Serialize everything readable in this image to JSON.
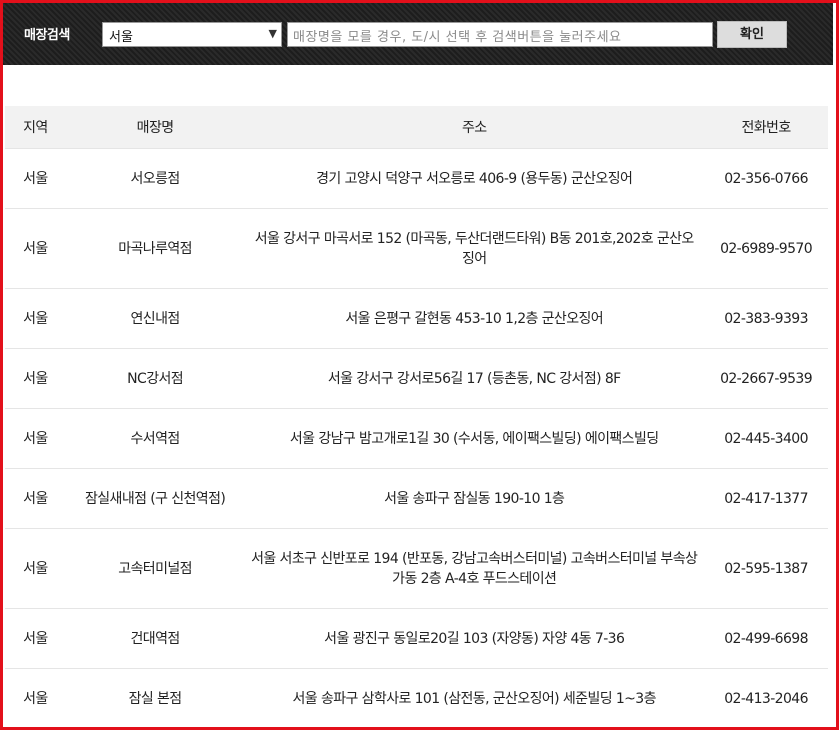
{
  "search": {
    "label": "매장검색",
    "region_value": "서울",
    "placeholder": "매장명을 모를 경우, 도/시 선택 후 검색버튼을 눌러주세요",
    "confirm_label": "확인"
  },
  "table": {
    "headers": {
      "region": "지역",
      "name": "매장명",
      "address": "주소",
      "phone": "전화번호"
    },
    "rows": [
      {
        "region": "서울",
        "name": "서오릉점",
        "address": "경기 고양시 덕양구 서오릉로 406-9 (용두동) 군산오징어",
        "phone": "02-356-0766"
      },
      {
        "region": "서울",
        "name": "마곡나루역점",
        "address": "서울 강서구 마곡서로 152 (마곡동, 두산더랜드타워) B동 201호,202호 군산오징어",
        "phone": "02-6989-9570"
      },
      {
        "region": "서울",
        "name": "연신내점",
        "address": "서울 은평구 갈현동 453-10 1,2층 군산오징어",
        "phone": "02-383-9393"
      },
      {
        "region": "서울",
        "name": "NC강서점",
        "address": "서울 강서구 강서로56길 17 (등촌동, NC 강서점) 8F",
        "phone": "02-2667-9539"
      },
      {
        "region": "서울",
        "name": "수서역점",
        "address": "서울 강남구 밤고개로1길 30 (수서동, 에이팩스빌딩) 에이팩스빌딩",
        "phone": "02-445-3400"
      },
      {
        "region": "서울",
        "name": "잠실새내점 (구 신천역점)",
        "address": "서울 송파구 잠실동 190-10 1층",
        "phone": "02-417-1377"
      },
      {
        "region": "서울",
        "name": "고속터미널점",
        "address": "서울 서초구 신반포로 194 (반포동, 강남고속버스터미널) 고속버스터미널 부속상가동 2층 A-4호 푸드스테이션",
        "phone": "02-595-1387"
      },
      {
        "region": "서울",
        "name": "건대역점",
        "address": "서울 광진구 동일로20길 103 (자양동) 자양 4동 7-36",
        "phone": "02-499-6698"
      },
      {
        "region": "서울",
        "name": "잠실 본점",
        "address": "서울 송파구 삼학사로 101 (삼전동, 군산오징어) 세준빌딩 1~3층",
        "phone": "02-413-2046"
      }
    ]
  },
  "colors": {
    "border": "#e3101b",
    "header_bg": "#1d1d1d",
    "table_header_bg": "#f2f2f2"
  },
  "icons": {
    "select_arrow": "chevron-down-icon"
  }
}
